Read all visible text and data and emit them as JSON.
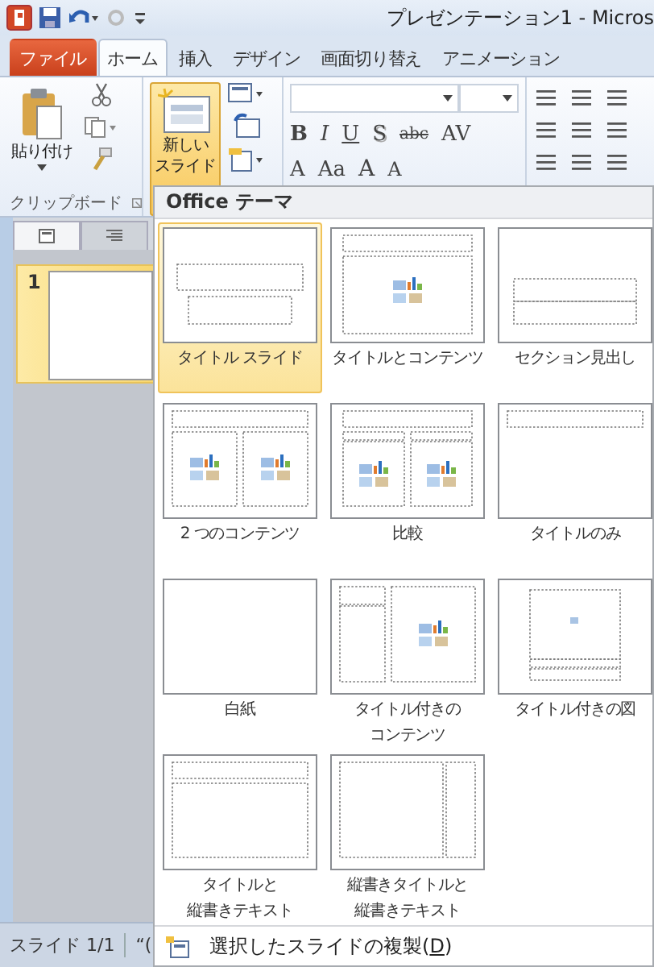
{
  "title_bar": {
    "title": "プレゼンテーション1 - Micros"
  },
  "tabs": [
    {
      "label": "ファイル",
      "kind": "file",
      "selected": false
    },
    {
      "label": "ホーム",
      "kind": "tab",
      "selected": true
    },
    {
      "label": "挿入",
      "kind": "tab",
      "selected": false
    },
    {
      "label": "デザイン",
      "kind": "tab",
      "selected": false
    },
    {
      "label": "画面切り替え",
      "kind": "tab",
      "selected": false
    },
    {
      "label": "アニメーション",
      "kind": "tab",
      "selected": false
    }
  ],
  "clipboard": {
    "paste_label": "貼り付け",
    "group_label": "クリップボード"
  },
  "new_slide": {
    "lines": [
      "新しい",
      "スライド"
    ],
    "pressed": true
  },
  "font_buttons": [
    "B",
    "I",
    "U",
    "S",
    "abc",
    "AV"
  ],
  "font_size_buttons": [
    "A",
    "Aa",
    "A",
    "A"
  ],
  "slide_pane": {
    "slides": [
      {
        "number": "1",
        "selected": true
      }
    ]
  },
  "status_bar": [
    "スライド 1/1",
    "“("
  ],
  "gallery": {
    "title": "Office テーマ",
    "layouts": [
      {
        "label": "タイトル スライド",
        "kind": "title-slide",
        "selected": true
      },
      {
        "label": "タイトルとコンテンツ",
        "kind": "title-content",
        "selected": false
      },
      {
        "label": "セクション見出し",
        "kind": "section",
        "selected": false
      },
      {
        "label": "2 つのコンテンツ",
        "kind": "two-content",
        "selected": false
      },
      {
        "label": "比較",
        "kind": "comparison",
        "selected": false
      },
      {
        "label": "タイトルのみ",
        "kind": "title-only",
        "selected": false
      },
      {
        "label": "白紙",
        "kind": "blank",
        "selected": false
      },
      {
        "lines": [
          "タイトル付きの",
          "コンテンツ"
        ],
        "kind": "content-caption",
        "selected": false
      },
      {
        "label": "タイトル付きの図",
        "kind": "picture-caption",
        "selected": false
      },
      {
        "lines": [
          "タイトルと",
          "縦書きテキスト"
        ],
        "kind": "vertical-text",
        "selected": false
      },
      {
        "lines": [
          "縦書きタイトルと",
          "縦書きテキスト"
        ],
        "kind": "vertical-title",
        "selected": false
      }
    ],
    "footer": {
      "before": "選択したスライドの複製(",
      "key": "D",
      "after": ")"
    }
  }
}
